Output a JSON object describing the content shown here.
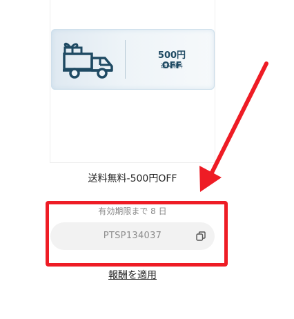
{
  "coupon": {
    "amount": "500円 OFF",
    "subtitle": "送料無料",
    "icon": "truck-gift-icon"
  },
  "coupon_name": "送料無料-500円OFF",
  "validity_text": "有効期限まで 8 日",
  "code": {
    "value": "PTSP134037",
    "copy_icon": "copy-icon"
  },
  "apply_label": "報酬を適用",
  "colors": {
    "highlight": "#ee1c25",
    "coupon_text": "#1f4a63",
    "code_bg": "#f2f2f2"
  }
}
